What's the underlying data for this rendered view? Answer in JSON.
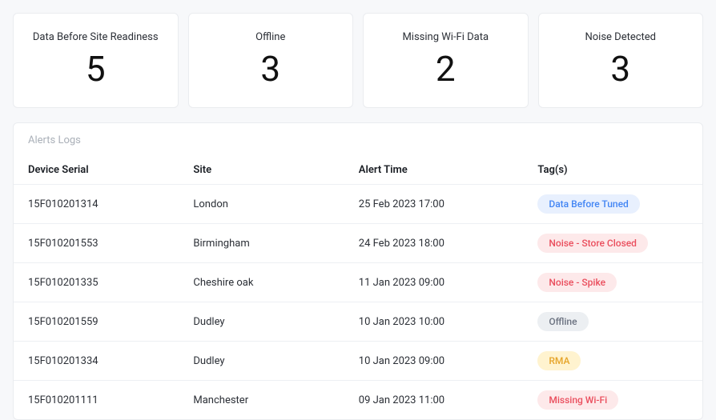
{
  "cards": [
    {
      "title": "Data Before Site Readiness",
      "value": "5"
    },
    {
      "title": "Offline",
      "value": "3"
    },
    {
      "title": "Missing Wi-Fi Data",
      "value": "2"
    },
    {
      "title": "Noise Detected",
      "value": "3"
    }
  ],
  "panel": {
    "title": "Alerts Logs",
    "headers": {
      "serial": "Device Serial",
      "site": "Site",
      "time": "Alert Time",
      "tags": "Tag(s)"
    },
    "rows": [
      {
        "serial": "15F010201314",
        "site": "London",
        "time": "25 Feb 2023 17:00",
        "tag": "Data Before Tuned",
        "tagClass": "tag-blue"
      },
      {
        "serial": "15F010201553",
        "site": "Birmingham",
        "time": "24 Feb 2023 18:00",
        "tag": "Noise - Store Closed",
        "tagClass": "tag-red"
      },
      {
        "serial": "15F010201335",
        "site": "Cheshire oak",
        "time": "11 Jan 2023 09:00",
        "tag": "Noise - Spike",
        "tagClass": "tag-red"
      },
      {
        "serial": "15F010201559",
        "site": "Dudley",
        "time": "10 Jan 2023 10:00",
        "tag": "Offline",
        "tagClass": "tag-gray"
      },
      {
        "serial": "15F010201334",
        "site": "Dudley",
        "time": "10 Jan 2023 09:00",
        "tag": "RMA",
        "tagClass": "tag-yellow"
      },
      {
        "serial": "15F010201111",
        "site": "Manchester",
        "time": "09 Jan 2023 11:00",
        "tag": "Missing Wi-Fi",
        "tagClass": "tag-red"
      }
    ]
  }
}
